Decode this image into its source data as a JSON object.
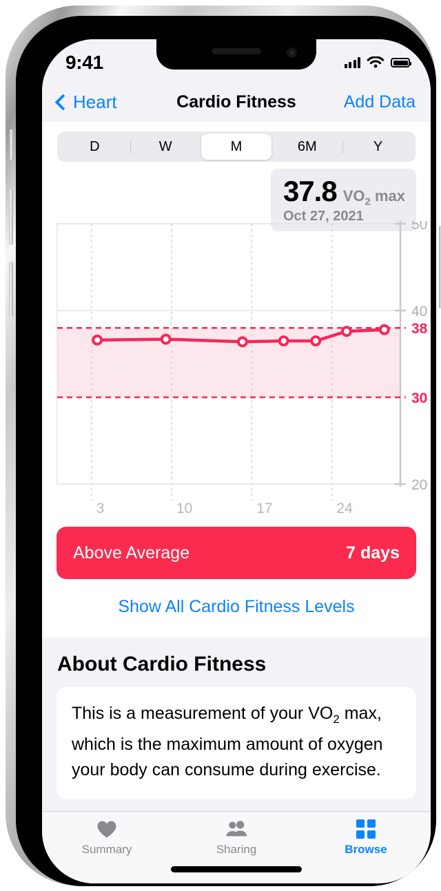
{
  "status_bar": {
    "time": "9:41",
    "cellular_icon": "cellular-bars-icon",
    "wifi_icon": "wifi-icon",
    "battery_icon": "battery-icon"
  },
  "nav": {
    "back_label": "Heart",
    "back_icon": "chevron-left-icon",
    "title": "Cardio Fitness",
    "action_label": "Add Data"
  },
  "segmented": {
    "options": [
      "D",
      "W",
      "M",
      "6M",
      "Y"
    ],
    "selected": "M"
  },
  "callout": {
    "value": "37.8",
    "unit_prefix": "VO",
    "unit_sub": "2",
    "unit_suffix": " max",
    "date": "Oct 27, 2021"
  },
  "banner": {
    "label": "Above Average",
    "value": "7 days",
    "color": "#fa2b4e"
  },
  "links": {
    "show_all": "Show All Cardio Fitness Levels"
  },
  "about": {
    "title": "About Cardio Fitness",
    "body_line1": "This is a measurement of your VO",
    "body_sub": "2",
    "body_line1b": " max,",
    "body_line2": "which is the maximum amount of oxygen",
    "body_line3": "your body can consume during exercise."
  },
  "tabs": [
    {
      "label": "Summary",
      "icon": "heart-icon",
      "active": false
    },
    {
      "label": "Sharing",
      "icon": "people-icon",
      "active": false
    },
    {
      "label": "Browse",
      "icon": "grid-squares-icon",
      "active": true
    }
  ],
  "chart_data": {
    "type": "line",
    "title": "Cardio Fitness",
    "xlabel": "",
    "ylabel": "VO2 max",
    "ylim": [
      20,
      50
    ],
    "yticks": [
      20,
      30,
      40,
      50
    ],
    "ytick_labels": [
      "20",
      "30",
      "40",
      "50"
    ],
    "highlight_yticks": [
      30,
      38
    ],
    "highlight_ytick_labels": [
      "30",
      "38"
    ],
    "xlim": [
      0,
      30
    ],
    "xticks": [
      3,
      10,
      17,
      24
    ],
    "xtick_labels": [
      "3",
      "10",
      "17",
      "24"
    ],
    "grid": true,
    "legend": false,
    "band": {
      "label": "Above Average",
      "y_low": 30,
      "y_high": 38,
      "color": "#fce8ec"
    },
    "series": [
      {
        "name": "VO2 max",
        "color": "#f5275a",
        "x": [
          3.5,
          9.5,
          16.2,
          19.8,
          22.6,
          25.3,
          28.6
        ],
        "values": [
          36.6,
          36.7,
          36.4,
          36.5,
          36.5,
          37.6,
          37.8
        ]
      }
    ],
    "last_value": 37.8,
    "last_date": "Oct 27, 2021"
  }
}
